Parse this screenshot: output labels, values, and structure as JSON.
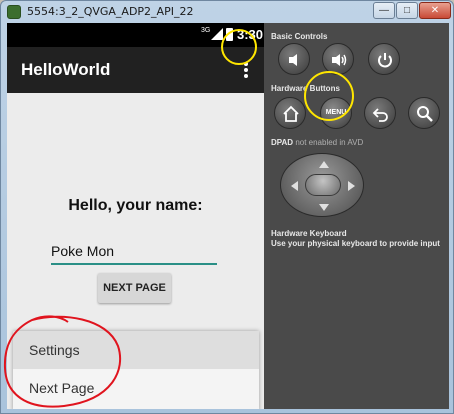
{
  "window": {
    "title": "5554:3_2_QVGA_ADP2_API_22",
    "min_glyph": "—",
    "max_glyph": "□",
    "close_glyph": "✕"
  },
  "status_bar": {
    "network": "3G",
    "time": "3:30"
  },
  "app_bar": {
    "title": "HelloWorld",
    "overflow_icon": "more-vert-icon"
  },
  "main": {
    "prompt": "Hello, your name:",
    "name_value": "Poke Mon",
    "next_button_label": "NEXT PAGE"
  },
  "overflow_menu": {
    "items": [
      {
        "label": "Settings"
      },
      {
        "label": "Next Page"
      }
    ]
  },
  "controls": {
    "basic_label": "Basic Controls",
    "basic_buttons": [
      "volume-down-icon",
      "volume-up-icon",
      "power-icon"
    ],
    "hardware_label": "Hardware Buttons",
    "menu_button_label": "MENU",
    "hardware_buttons": [
      "home-icon",
      "menu-button",
      "back-icon",
      "search-icon"
    ],
    "dpad_label": "DPAD",
    "dpad_note": "not enabled in AVD",
    "keyboard_label": "Hardware Keyboard",
    "keyboard_note": "Use your physical keyboard to provide input"
  },
  "annotations": {
    "highlight_color_yellow": "#ffe600",
    "highlight_color_red": "#e0141e"
  }
}
